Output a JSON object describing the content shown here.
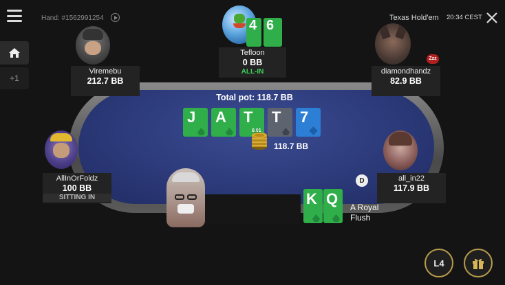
{
  "header": {
    "hand_id": "Hand: #1562991254",
    "game_name": "Texas Hold'em",
    "clock": "20:34 CEST"
  },
  "sidebar": {
    "home_icon": "home-icon",
    "plus_label": "+1"
  },
  "table": {
    "total_pot": "Total pot: 118.7 BB",
    "bet_chip_label": "0.01",
    "bet_amount": "118.7 BB",
    "dealer_label": "D",
    "hand_rank": [
      "A Royal",
      "Flush"
    ],
    "community_cards": [
      {
        "rank": "J",
        "suit": "clubs",
        "color": "#2fae4a"
      },
      {
        "rank": "A",
        "suit": "clubs",
        "color": "#2fae4a"
      },
      {
        "rank": "T",
        "suit": "clubs",
        "color": "#2fae4a"
      },
      {
        "rank": "T",
        "suit": "spades",
        "color": "#5d6470"
      },
      {
        "rank": "7",
        "suit": "diamonds",
        "color": "#2d7fd6"
      }
    ]
  },
  "players": {
    "tefloon": {
      "name": "Tefloon",
      "stack": "0 BB",
      "status": "ALL-IN",
      "cards": [
        "4",
        "6"
      ]
    },
    "viremebu": {
      "name": "Viremebu",
      "stack": "212.7 BB"
    },
    "diamondhandz": {
      "name": "diamondhandz",
      "stack": "82.9 BB",
      "badge": "Zzz"
    },
    "allinorfoldz": {
      "name": "AllInOrFoldz",
      "stack": "100 BB",
      "status": "SITTING IN"
    },
    "all_in22": {
      "name": "all_in22",
      "stack": "117.9 BB"
    },
    "hero": {
      "cards": [
        "K",
        "Q"
      ]
    }
  },
  "buttons": {
    "level": "L4",
    "gift_icon": "gift-icon"
  },
  "colors": {
    "felt": "#2c3a7a",
    "status_green": "#3ecf5a",
    "card_green": "#2fae4a",
    "card_blue": "#2d7fd6",
    "card_grey": "#5d6470"
  }
}
